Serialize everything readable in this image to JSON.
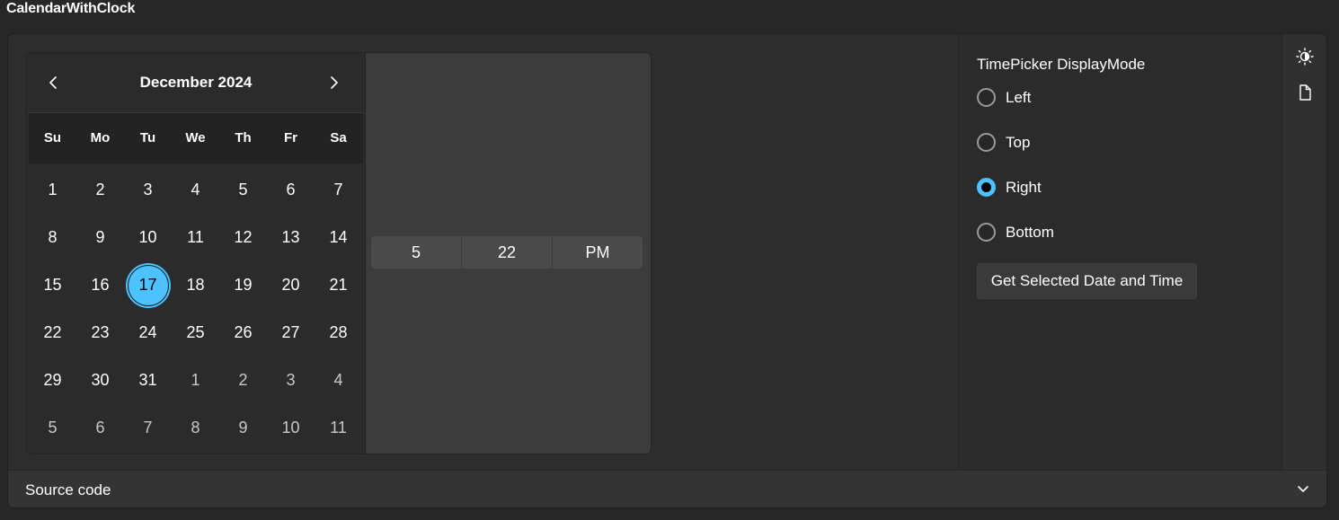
{
  "page": {
    "title": "CalendarWithClock"
  },
  "calendar": {
    "month_title": "December 2024",
    "prev_icon": "chevron-left-icon",
    "next_icon": "chevron-right-icon",
    "weekdays": [
      "Su",
      "Mo",
      "Tu",
      "We",
      "Th",
      "Fr",
      "Sa"
    ],
    "days": [
      {
        "label": "1",
        "other": false
      },
      {
        "label": "2",
        "other": false
      },
      {
        "label": "3",
        "other": false
      },
      {
        "label": "4",
        "other": false
      },
      {
        "label": "5",
        "other": false
      },
      {
        "label": "6",
        "other": false
      },
      {
        "label": "7",
        "other": false
      },
      {
        "label": "8",
        "other": false
      },
      {
        "label": "9",
        "other": false
      },
      {
        "label": "10",
        "other": false
      },
      {
        "label": "11",
        "other": false
      },
      {
        "label": "12",
        "other": false
      },
      {
        "label": "13",
        "other": false
      },
      {
        "label": "14",
        "other": false
      },
      {
        "label": "15",
        "other": false
      },
      {
        "label": "16",
        "other": false
      },
      {
        "label": "17",
        "other": false,
        "selected": true
      },
      {
        "label": "18",
        "other": false
      },
      {
        "label": "19",
        "other": false
      },
      {
        "label": "20",
        "other": false
      },
      {
        "label": "21",
        "other": false
      },
      {
        "label": "22",
        "other": false
      },
      {
        "label": "23",
        "other": false
      },
      {
        "label": "24",
        "other": false
      },
      {
        "label": "25",
        "other": false
      },
      {
        "label": "26",
        "other": false
      },
      {
        "label": "27",
        "other": false
      },
      {
        "label": "28",
        "other": false
      },
      {
        "label": "29",
        "other": false
      },
      {
        "label": "30",
        "other": false
      },
      {
        "label": "31",
        "other": false
      },
      {
        "label": "1",
        "other": true
      },
      {
        "label": "2",
        "other": true
      },
      {
        "label": "3",
        "other": true
      },
      {
        "label": "4",
        "other": true
      },
      {
        "label": "5",
        "other": true
      },
      {
        "label": "6",
        "other": true
      },
      {
        "label": "7",
        "other": true
      },
      {
        "label": "8",
        "other": true
      },
      {
        "label": "9",
        "other": true
      },
      {
        "label": "10",
        "other": true
      },
      {
        "label": "11",
        "other": true
      }
    ]
  },
  "time_picker": {
    "hour": "5",
    "minute": "22",
    "period": "PM"
  },
  "options": {
    "title": "TimePicker DisplayMode",
    "radios": [
      {
        "label": "Left",
        "checked": false
      },
      {
        "label": "Top",
        "checked": false
      },
      {
        "label": "Right",
        "checked": true
      },
      {
        "label": "Bottom",
        "checked": false
      }
    ],
    "action_label": "Get Selected Date and Time"
  },
  "toolbar": {
    "icons": [
      "theme-toggle-icon",
      "document-icon"
    ]
  },
  "source": {
    "label": "Source code",
    "expand_icon": "chevron-down-icon"
  },
  "colors": {
    "accent": "#4cc2ff",
    "background": "#272727"
  }
}
